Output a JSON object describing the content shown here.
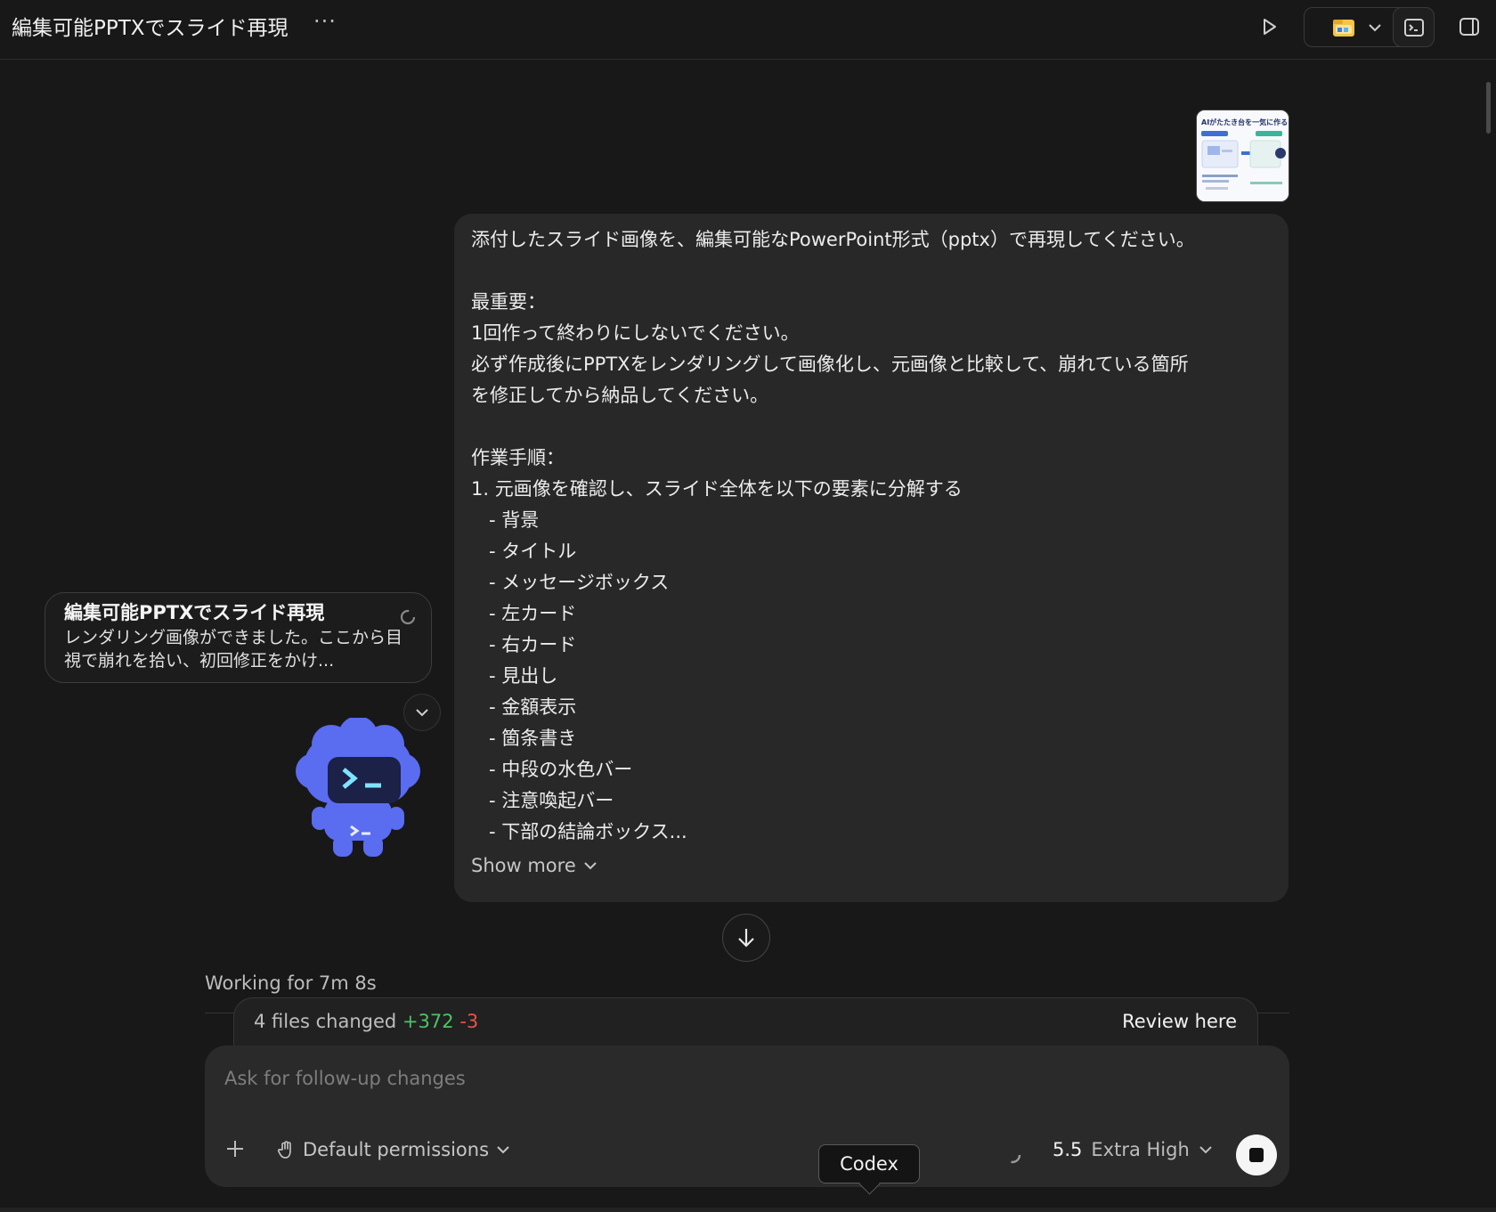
{
  "header": {
    "title": "編集可能PPTXでスライド再現",
    "more_label": "···"
  },
  "attachment": {
    "thumbnail_caption": "AIがたたき台を一気に作る"
  },
  "message": {
    "lines": [
      "添付したスライド画像を、編集可能なPowerPoint形式（pptx）で再現してください。",
      "",
      "最重要：",
      "1回作って終わりにしないでください。",
      "必ず作成後にPPTXをレンダリングして画像化し、元画像と比較して、崩れている箇所",
      "を修正してから納品してください。",
      "",
      "作業手順：",
      "1. 元画像を確認し、スライド全体を以下の要素に分解する",
      "   - 背景",
      "   - タイトル",
      "   - メッセージボックス",
      "   - 左カード",
      "   - 右カード",
      "   - 見出し",
      "   - 金額表示",
      "   - 箇条書き",
      "   - 中段の水色バー",
      "   - 注意喚起バー",
      "   - 下部の結論ボックス..."
    ],
    "show_more": "Show more"
  },
  "notification": {
    "title": "編集可能PPTXでスライド再現",
    "body": "レンダリング画像ができました。ここから目視で崩れを拾い、初回修正をかけ..."
  },
  "status": {
    "working": "Working for 7m 8s"
  },
  "changes": {
    "summary": "4 files changed",
    "additions": "+372",
    "deletions": "-3",
    "review": "Review here"
  },
  "composer": {
    "placeholder": "Ask for follow-up changes",
    "permissions": "Default permissions",
    "model_version": "5.5",
    "model_mode": "Extra High"
  },
  "tooltip": {
    "label": "Codex"
  },
  "colors": {
    "background": "#181818",
    "bubble": "#282828",
    "additions": "#4cc36a",
    "deletions": "#e5534b",
    "mascot": "#5a6cf0"
  }
}
